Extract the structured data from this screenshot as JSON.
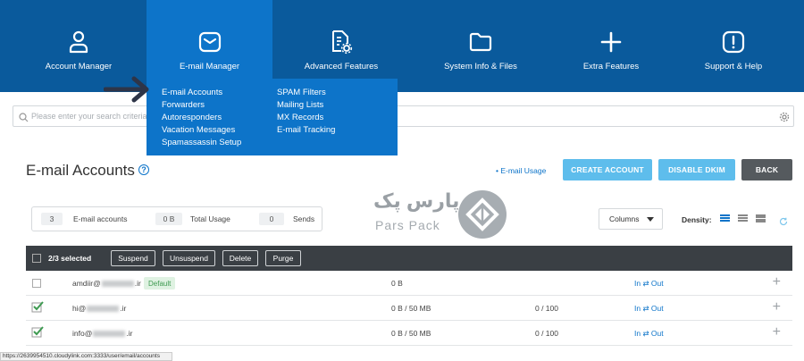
{
  "nav": [
    {
      "label": "Account Manager",
      "icon": "user-icon"
    },
    {
      "label": "E-mail Manager",
      "icon": "mail-icon"
    },
    {
      "label": "Advanced Features",
      "icon": "file-gear-icon"
    },
    {
      "label": "System Info & Files",
      "icon": "folder-icon"
    },
    {
      "label": "Extra Features",
      "icon": "plus-icon"
    },
    {
      "label": "Support & Help",
      "icon": "alert-icon"
    }
  ],
  "dropdown": {
    "col1": [
      "E-mail Accounts",
      "Forwarders",
      "Autoresponders",
      "Vacation Messages",
      "Spamassassin Setup"
    ],
    "col2": [
      "SPAM Filters",
      "Mailing Lists",
      "MX Records",
      "E-mail Tracking"
    ]
  },
  "search": {
    "placeholder": "Please enter your search criteria"
  },
  "page": {
    "title": "E-mail Accounts",
    "usage_link": "• E-mail Usage",
    "create_btn": "CREATE ACCOUNT",
    "dkim_btn": "DISABLE DKIM",
    "back_btn": "BACK"
  },
  "stats": {
    "accounts_num": "3",
    "accounts_lbl": "E-mail accounts",
    "usage_num": "0 B",
    "usage_lbl": "Total Usage",
    "sends_num": "0",
    "sends_lbl": "Sends"
  },
  "watermark": {
    "text": "پارس پک",
    "sub": "Pars Pack"
  },
  "toolbar": {
    "columns_label": "Columns",
    "density_label": "Density:"
  },
  "bulk": {
    "selected": "2/3 selected",
    "suspend": "Suspend",
    "unsuspend": "Unsuspend",
    "delete": "Delete",
    "purge": "Purge"
  },
  "rows": [
    {
      "email_user": "amdiir@",
      "email_tld": ".ir",
      "badge": "Default",
      "usage": "0 B",
      "sends": "",
      "inout": "In ⇄ Out",
      "checked": false
    },
    {
      "email_user": "hi@",
      "email_tld": ".ir",
      "badge": "",
      "usage": "0 B / 50 MB",
      "sends": "0 / 100",
      "inout": "In ⇄ Out",
      "checked": true
    },
    {
      "email_user": "info@",
      "email_tld": ".ir",
      "badge": "",
      "usage": "0 B / 50 MB",
      "sends": "0 / 100",
      "inout": "In ⇄ Out",
      "checked": true
    }
  ],
  "status_url": "https://2639954510.cloudylink.com:3333/user/email/accounts",
  "colors": {
    "nav_bg": "#0a5a9c",
    "nav_active": "#0d74c9",
    "accent": "#5ebdec",
    "check": "#3e9a51"
  }
}
